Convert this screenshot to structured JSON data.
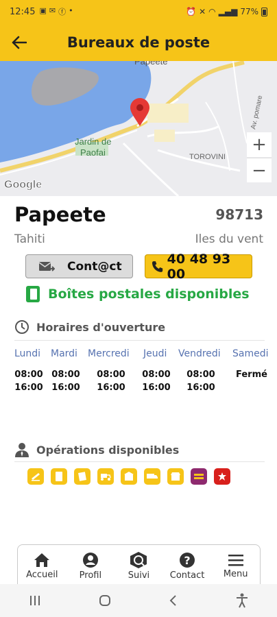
{
  "status": {
    "time": "12:45",
    "battery": "77%"
  },
  "header": {
    "title": "Bureaux de poste"
  },
  "map": {
    "label_city": "Papeete",
    "label_park": "Jardin de Paofai",
    "label_park_line1": "Jardin de",
    "label_park_line2": "Paofai",
    "label_district": "TOROVINI",
    "label_road": "Av. pomare",
    "attribution": "Google"
  },
  "office": {
    "name": "Papeete",
    "postcode": "98713",
    "island": "Tahiti",
    "region": "Iles du vent"
  },
  "actions": {
    "contact_label": "Cont@ct",
    "phone": "40 48 93 00"
  },
  "po_boxes": "Boîtes postales disponibles",
  "hours": {
    "title": "Horaires d'ouverture",
    "days": [
      {
        "day": "Lundi",
        "open": "08:00",
        "close": "16:00"
      },
      {
        "day": "Mardi",
        "open": "08:00",
        "close": "16:00"
      },
      {
        "day": "Mercredi",
        "open": "08:00",
        "close": "16:00"
      },
      {
        "day": "Jeudi",
        "open": "08:00",
        "close": "16:00"
      },
      {
        "day": "Vendredi",
        "open": "08:00",
        "close": "16:00"
      },
      {
        "day": "Samedi",
        "closed": "Fermé"
      }
    ]
  },
  "operations": {
    "title": "Opérations disponibles",
    "icons": [
      "letters-icon",
      "mail-icon",
      "parcel-icon",
      "delivery-scooter-icon",
      "counter-icon",
      "truck-icon",
      "shop-icon",
      "western-union-icon",
      "vini-icon"
    ]
  },
  "nav": {
    "home": "Accueil",
    "profile": "Profil",
    "tracking": "Suivi",
    "contact": "Contact",
    "menu": "Menu"
  },
  "colors": {
    "brand": "#f6c418",
    "success": "#27a844",
    "link": "#5672b0"
  }
}
